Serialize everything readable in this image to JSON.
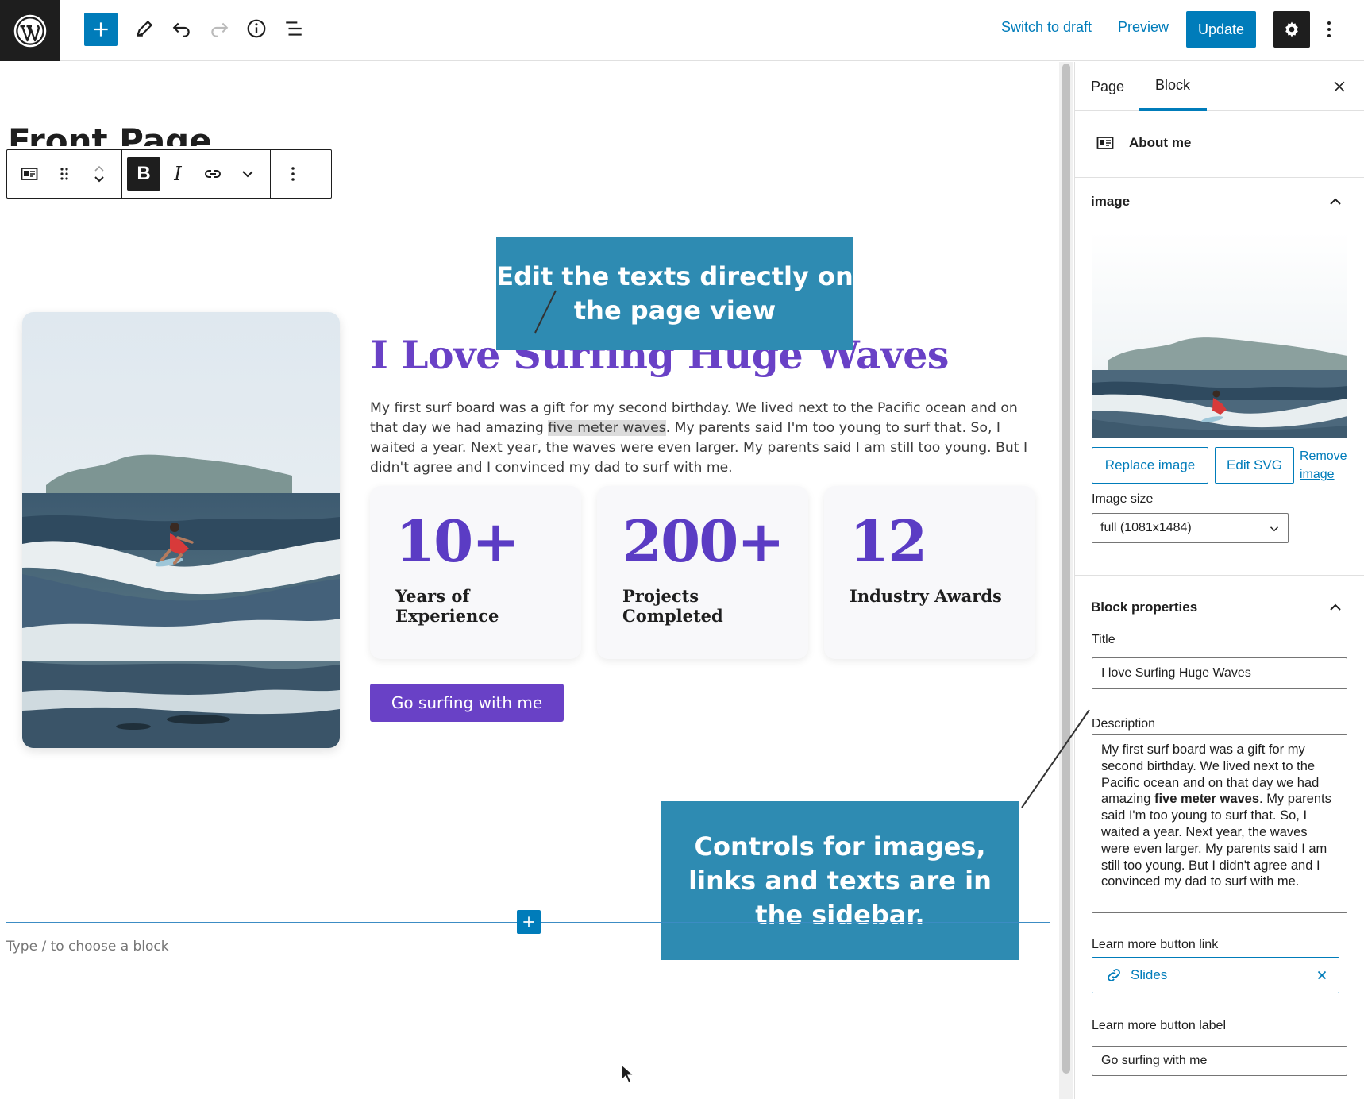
{
  "topbar": {
    "switch_to_draft": "Switch to draft",
    "preview": "Preview",
    "update": "Update",
    "icons": [
      "wordpress-logo-icon",
      "plus-icon",
      "pencil-icon",
      "undo-icon",
      "redo-icon",
      "info-icon",
      "list-view-icon",
      "gear-icon",
      "more-vertical-icon"
    ]
  },
  "editor": {
    "page_title": "Front Page",
    "hero": {
      "title": "I Love Surfing Huge Waves",
      "desc_part1": "My first surf board was a gift for my second birthday. We lived next to the Pacific ocean and on that day we had amazing ",
      "desc_highlight": "five meter waves",
      "desc_part2": ". My parents said I'm too young to surf that. So, I waited a year. Next year, the waves were even larger. My parents said I am still too young. But I didn't agree and I convinced my dad to surf with me.",
      "stats": [
        {
          "number": "10+",
          "label": "Years of Experience"
        },
        {
          "number": "200+",
          "label": "Projects Completed"
        },
        {
          "number": "12",
          "label": "Industry Awards"
        }
      ],
      "cta": "Go surfing with me"
    },
    "callouts": {
      "top": "Edit the texts directly on the page view",
      "bottom": "Controls for images, links and texts are in the sidebar."
    },
    "type_hint": "Type / to choose a block",
    "toolbar": {
      "bold": "B",
      "italic": "I"
    }
  },
  "sidebar": {
    "tabs": {
      "page": "Page",
      "block": "Block"
    },
    "block_name": "About me",
    "image_section": "image",
    "replace_image": "Replace image",
    "edit_svg": "Edit SVG",
    "remove_image": "Remove image",
    "image_size_label": "Image size",
    "image_size_value": "full (1081x1484)",
    "block_properties": "Block properties",
    "title_label": "Title",
    "title_value": "I love Surfing Huge Waves",
    "description_label": "Description",
    "description_part1": "My first surf board was a gift for my second birthday. We lived next to the Pacific ocean and on that day we had amazing ",
    "description_bold": "five meter waves",
    "description_part2": ". My parents said I'm too young to surf that. So, I waited a year. Next year, the waves were even larger. My parents said I am still too young. But I didn't agree and I convinced my dad to surf with me.",
    "learn_more_link_label": "Learn more button link",
    "learn_more_link_value": "Slides",
    "learn_more_label_label": "Learn more button label",
    "learn_more_label_value": "Go surfing with me"
  },
  "colors": {
    "accent": "#007cba",
    "purple": "#6941c6",
    "callout": "#2e8bb2",
    "dark": "#1e1e1e"
  }
}
